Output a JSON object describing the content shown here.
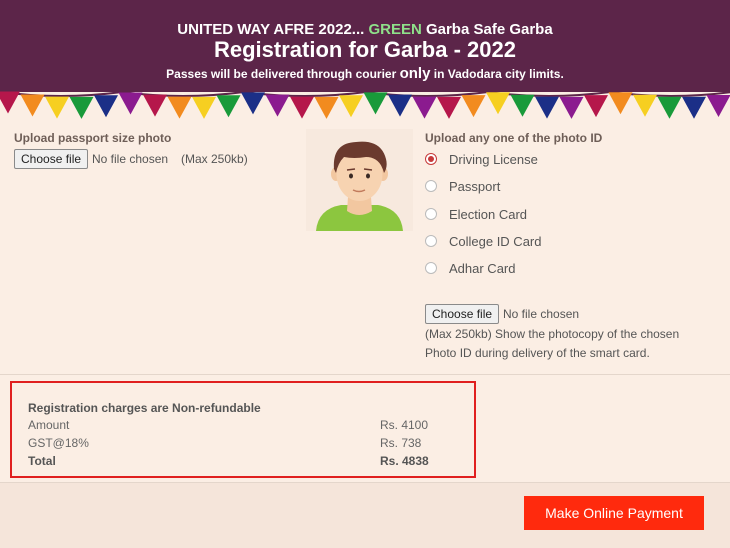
{
  "header": {
    "line1_prefix": "UNITED WAY AFRE 2022... ",
    "line1_green": "GREEN",
    "line1_suffix": " Garba Safe Garba",
    "title": "Registration for Garba - 2022",
    "notice_prefix": "Passes will be delivered through courier ",
    "notice_emph": "only",
    "notice_suffix": " in Vadodara city limits."
  },
  "bunting_colors": [
    "#b5174b",
    "#f28b1f",
    "#f6cf21",
    "#199a3a",
    "#1b2f87",
    "#8b1b8f"
  ],
  "photo_upload": {
    "label": "Upload passport size photo",
    "button": "Choose file",
    "status": "No file chosen",
    "hint": "(Max 250kb)"
  },
  "id_upload": {
    "label": "Upload any one of the photo ID",
    "options": [
      "Driving License",
      "Passport",
      "Election Card",
      "College ID Card",
      "Adhar Card"
    ],
    "selected": "Driving License",
    "button": "Choose file",
    "status": "No file chosen",
    "hint_line1": "(Max 250kb) Show the photocopy of the chosen",
    "hint_line2": "Photo ID during delivery of the smart card."
  },
  "charges": {
    "heading": "Registration charges are Non-refundable",
    "rows": [
      {
        "label": "Amount",
        "value": "Rs. 4100"
      },
      {
        "label": "GST@18%",
        "value": "Rs. 738"
      },
      {
        "label": "Total",
        "value": "Rs. 4838"
      }
    ]
  },
  "pay_button": "Make Online Payment"
}
